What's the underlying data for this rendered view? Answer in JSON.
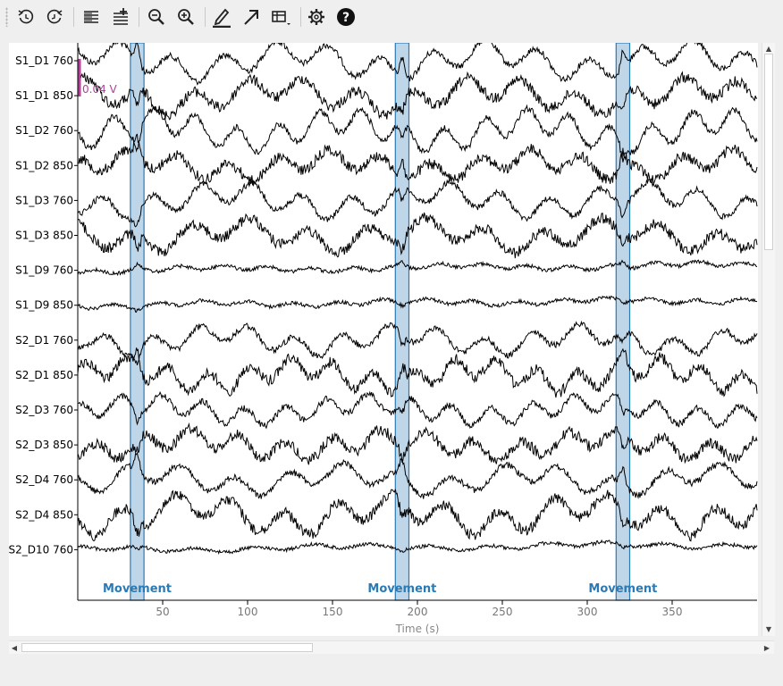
{
  "toolbar": {
    "buttons": [
      {
        "id": "rewind",
        "icon": "rewind-time-icon"
      },
      {
        "id": "forward",
        "icon": "forward-time-icon"
      },
      {
        "id": "fewer-channels",
        "icon": "fewer-channels-icon"
      },
      {
        "id": "more-channels",
        "icon": "more-channels-icon"
      },
      {
        "id": "zoom-out",
        "icon": "zoom-out-icon"
      },
      {
        "id": "zoom-in",
        "icon": "zoom-in-icon"
      },
      {
        "id": "annotate",
        "icon": "pencil-icon"
      },
      {
        "id": "scale",
        "icon": "arrow-icon"
      },
      {
        "id": "projector",
        "icon": "table-dropdown-icon"
      },
      {
        "id": "settings",
        "icon": "gear-icon"
      },
      {
        "id": "help",
        "icon": "help-icon"
      }
    ]
  },
  "colors": {
    "trace": "#000000",
    "annotation_fill": "#a9c8e2",
    "annotation_edge": "#2a7ab5",
    "annotation_label": "#2a7ab5",
    "scale_bar": "#b5409a"
  },
  "chart_data": {
    "type": "line",
    "xlabel": "Time (s)",
    "xlim": [
      0,
      400
    ],
    "xticks": [
      50,
      100,
      150,
      200,
      250,
      300,
      350
    ],
    "channels": [
      "S1_D1 760",
      "S1_D1 850",
      "S1_D2 760",
      "S1_D2 850",
      "S1_D3 760",
      "S1_D3 850",
      "S1_D9 760",
      "S1_D9 850",
      "S2_D1 760",
      "S2_D1 850",
      "S2_D3 760",
      "S2_D3 850",
      "S2_D4 760",
      "S2_D4 850",
      "S2_D10 760"
    ],
    "annotations": [
      {
        "label": "Movement",
        "onset": 31,
        "offset": 39
      },
      {
        "label": "Movement",
        "onset": 187,
        "offset": 195
      },
      {
        "label": "Movement",
        "onset": 317,
        "offset": 325
      }
    ],
    "scale_bar": {
      "label": "0.04 V"
    },
    "grid": false
  }
}
